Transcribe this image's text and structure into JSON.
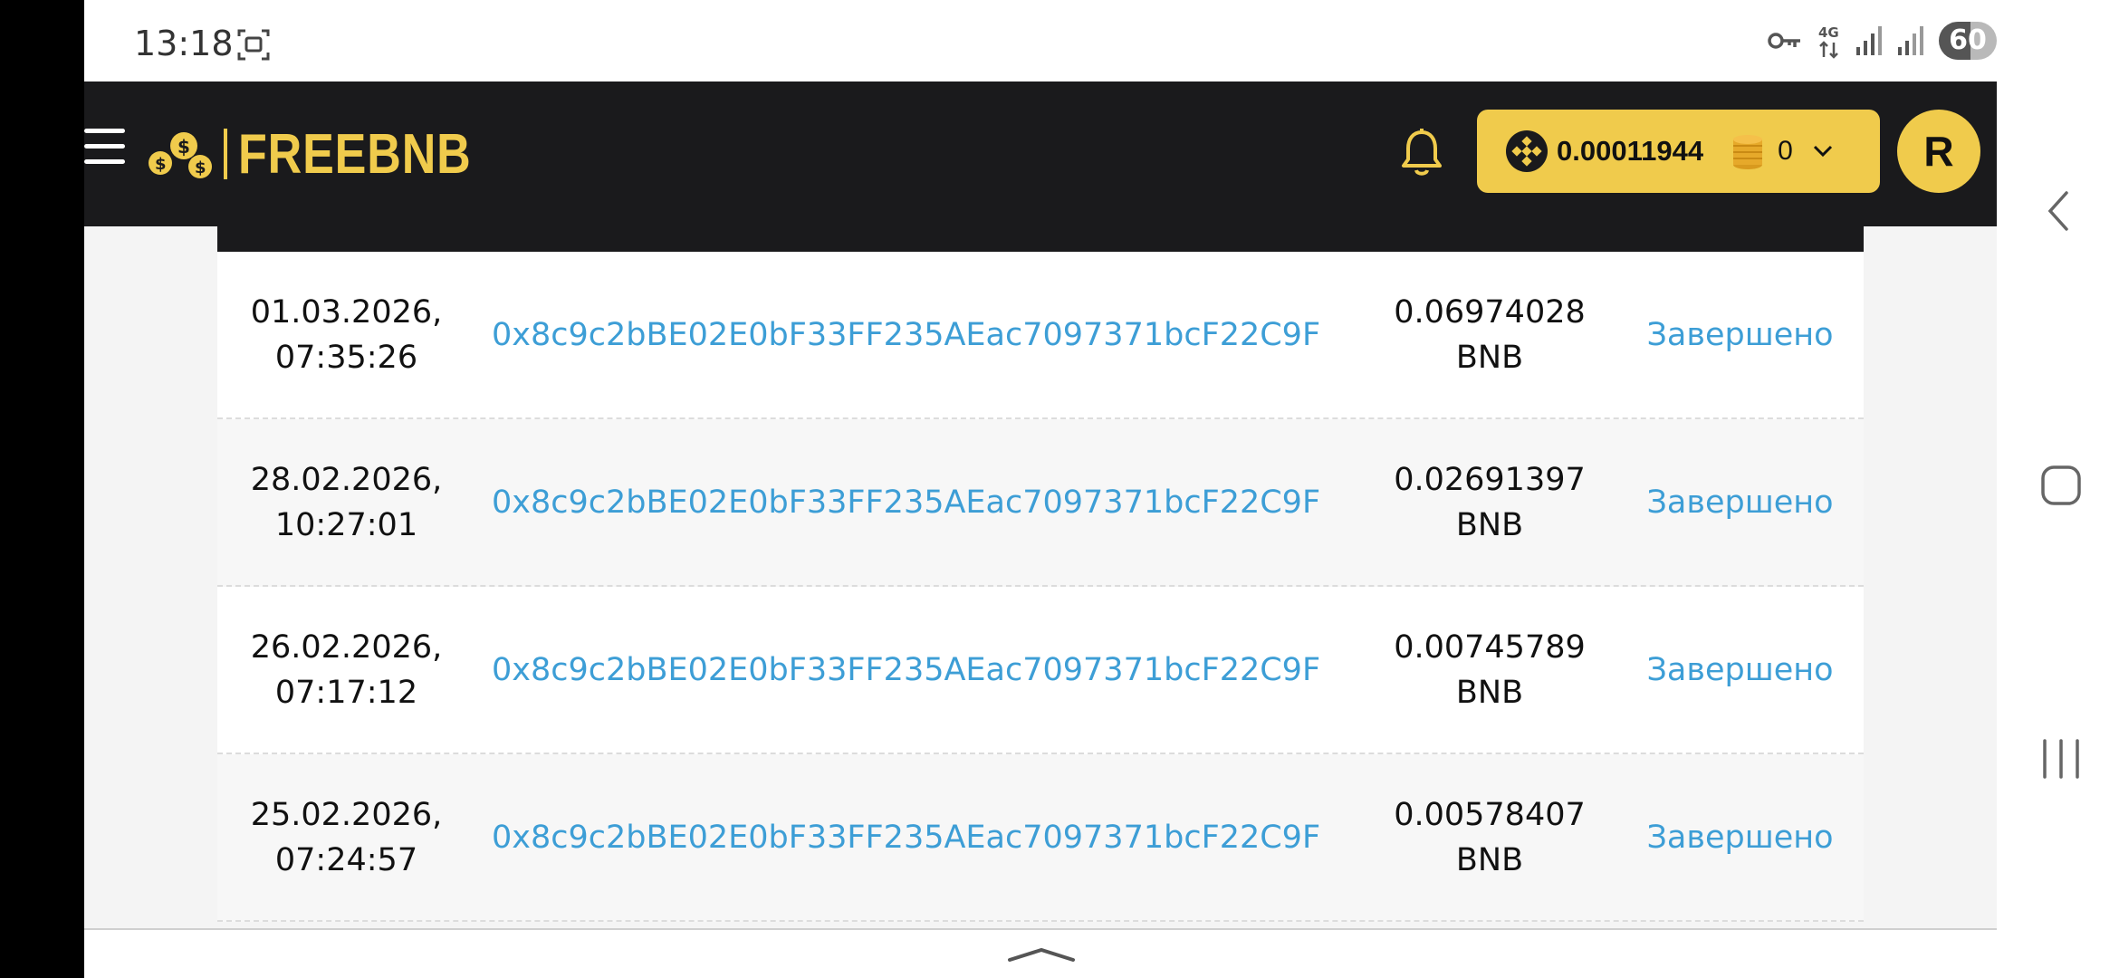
{
  "status_bar": {
    "time": "13:18",
    "battery": "60"
  },
  "header": {
    "logo_text": "FREEBNB",
    "balance": "0.00011944",
    "coins": "0",
    "avatar_letter": "R"
  },
  "table": {
    "rows": [
      {
        "date": "01.03.2026,",
        "time": "07:35:26",
        "address": "0x8c9c2bBE02E0bF33FF235AEac7097371bcF22C9F",
        "amount": "0.06974028",
        "currency": "BNB",
        "status": "Завершено"
      },
      {
        "date": "28.02.2026,",
        "time": "10:27:01",
        "address": "0x8c9c2bBE02E0bF33FF235AEac7097371bcF22C9F",
        "amount": "0.02691397",
        "currency": "BNB",
        "status": "Завершено"
      },
      {
        "date": "26.02.2026,",
        "time": "07:17:12",
        "address": "0x8c9c2bBE02E0bF33FF235AEac7097371bcF22C9F",
        "amount": "0.00745789",
        "currency": "BNB",
        "status": "Завершено"
      },
      {
        "date": "25.02.2026,",
        "time": "07:24:57",
        "address": "0x8c9c2bBE02E0bF33FF235AEac7097371bcF22C9F",
        "amount": "0.00578407",
        "currency": "BNB",
        "status": "Завершено"
      }
    ]
  },
  "colors": {
    "accent_yellow": "#f0cb4c",
    "header_dark": "#1a1a1c",
    "link_blue": "#3d9ed6"
  },
  "icons": [
    "screenshot-icon",
    "vpn-key-icon",
    "network-4g-icon",
    "signal-icon",
    "menu-icon",
    "coins-logo-icon",
    "bell-icon",
    "bnb-icon",
    "coin-stack-icon",
    "chevron-down-icon",
    "back-icon",
    "home-icon",
    "recents-icon",
    "chevron-up-icon"
  ]
}
